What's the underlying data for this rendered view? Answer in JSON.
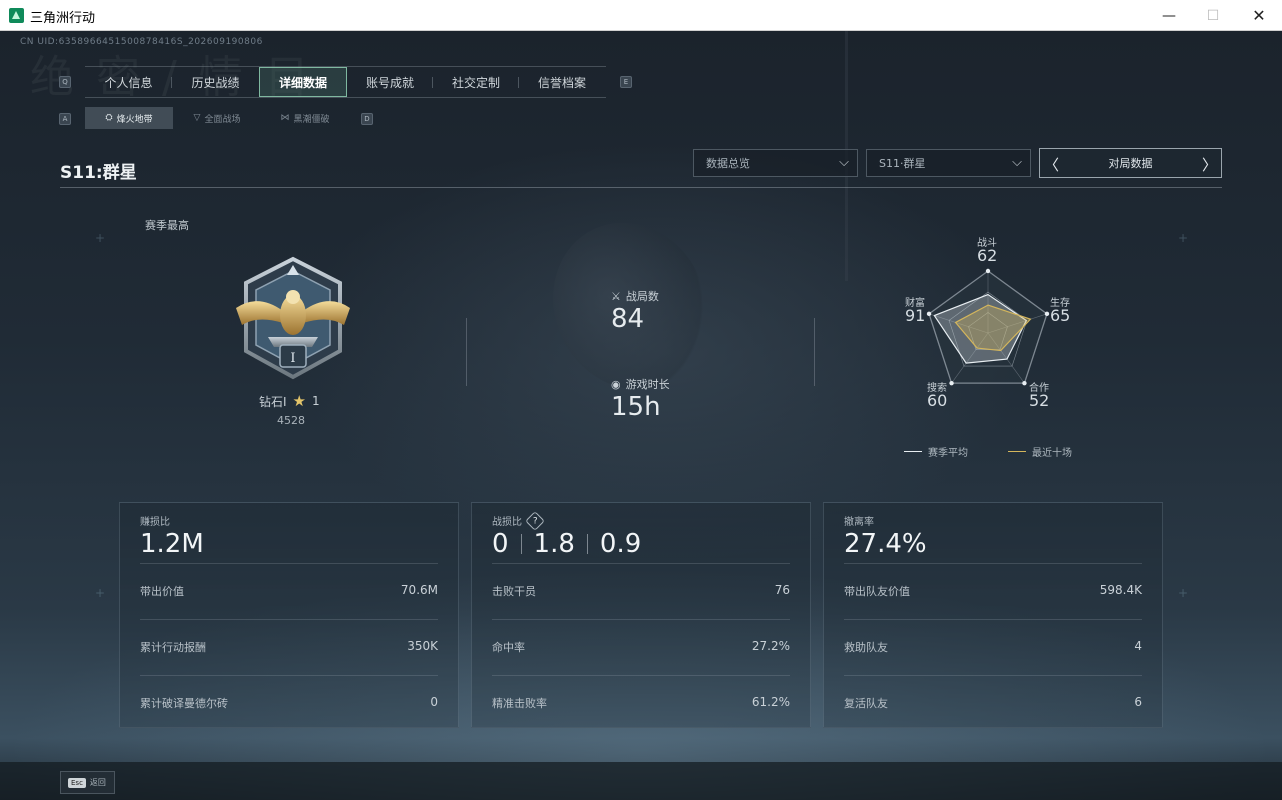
{
  "window": {
    "title": "三角洲行动",
    "min": "—",
    "max": "☐",
    "close": "✕"
  },
  "uid": "CN UID:6358966451500878416S_202609190806",
  "watermark": "绝 密 / 情 目",
  "main_tabs": {
    "key_left": "Q",
    "key_right": "E",
    "items": [
      {
        "label": "个人信息"
      },
      {
        "label": "历史战绩"
      },
      {
        "label": "详细数据",
        "active": true
      },
      {
        "label": "账号成就"
      },
      {
        "label": "社交定制"
      },
      {
        "label": "信誉档案"
      }
    ]
  },
  "sub_tabs": {
    "key_left": "A",
    "key_right": "D",
    "items": [
      {
        "label": "烽火地带",
        "icon": "⛭",
        "active": true
      },
      {
        "label": "全面战场",
        "icon": "▽"
      },
      {
        "label": "黑潮僵破",
        "icon": "⋈"
      }
    ]
  },
  "season_title": "S11:群星",
  "dropdowns": {
    "overview": {
      "value": "数据总览",
      "chev": "⌵"
    },
    "season": {
      "value": "S11·群星",
      "chev": "⌵"
    },
    "nav": {
      "label": "对局数据",
      "prev": "〈",
      "next": "〉"
    }
  },
  "rank": {
    "season_high_label": "赛季最高",
    "tier": "钻石I",
    "star": "★",
    "stars": "1",
    "score": "4528",
    "badge_numeral": "I"
  },
  "stats": {
    "matches": {
      "label": "战局数",
      "value": "84",
      "icon": "⚔"
    },
    "playtime": {
      "label": "游戏时长",
      "value": "15h",
      "icon": "◉"
    }
  },
  "radar": {
    "axes": [
      {
        "label": "战斗",
        "value": "62"
      },
      {
        "label": "生存",
        "value": "65"
      },
      {
        "label": "合作",
        "value": "52"
      },
      {
        "label": "搜索",
        "value": "60"
      },
      {
        "label": "财富",
        "value": "91"
      }
    ],
    "season_avg": [
      0.62,
      0.65,
      0.52,
      0.6,
      0.91
    ],
    "recent_ten": [
      0.45,
      0.72,
      0.35,
      0.3,
      0.55
    ],
    "legend": {
      "season_avg": "赛季平均",
      "recent_ten": "最近十场"
    },
    "colors": {
      "season_avg": "#e8eef2",
      "recent_ten": "#d4b65c"
    }
  },
  "cards": {
    "profit": {
      "title": "赚损比",
      "value": "1.2M",
      "rows": [
        {
          "label": "带出价值",
          "value": "70.6M"
        },
        {
          "label": "累计行动报酬",
          "value": "350K"
        },
        {
          "label": "累计破译曼德尔砖",
          "value": "0"
        }
      ]
    },
    "combat": {
      "title": "战损比",
      "help": "?",
      "values": [
        "0",
        "1.8",
        "0.9"
      ],
      "rows": [
        {
          "label": "击败干员",
          "value": "76"
        },
        {
          "label": "命中率",
          "value": "27.2%"
        },
        {
          "label": "精准击败率",
          "value": "61.2%"
        }
      ]
    },
    "extract": {
      "title": "撤离率",
      "value": "27.4%",
      "rows": [
        {
          "label": "带出队友价值",
          "value": "598.4K"
        },
        {
          "label": "救助队友",
          "value": "4"
        },
        {
          "label": "复活队友",
          "value": "6"
        }
      ]
    }
  },
  "footer": {
    "esc_key": "Esc",
    "back_label": "返回"
  }
}
